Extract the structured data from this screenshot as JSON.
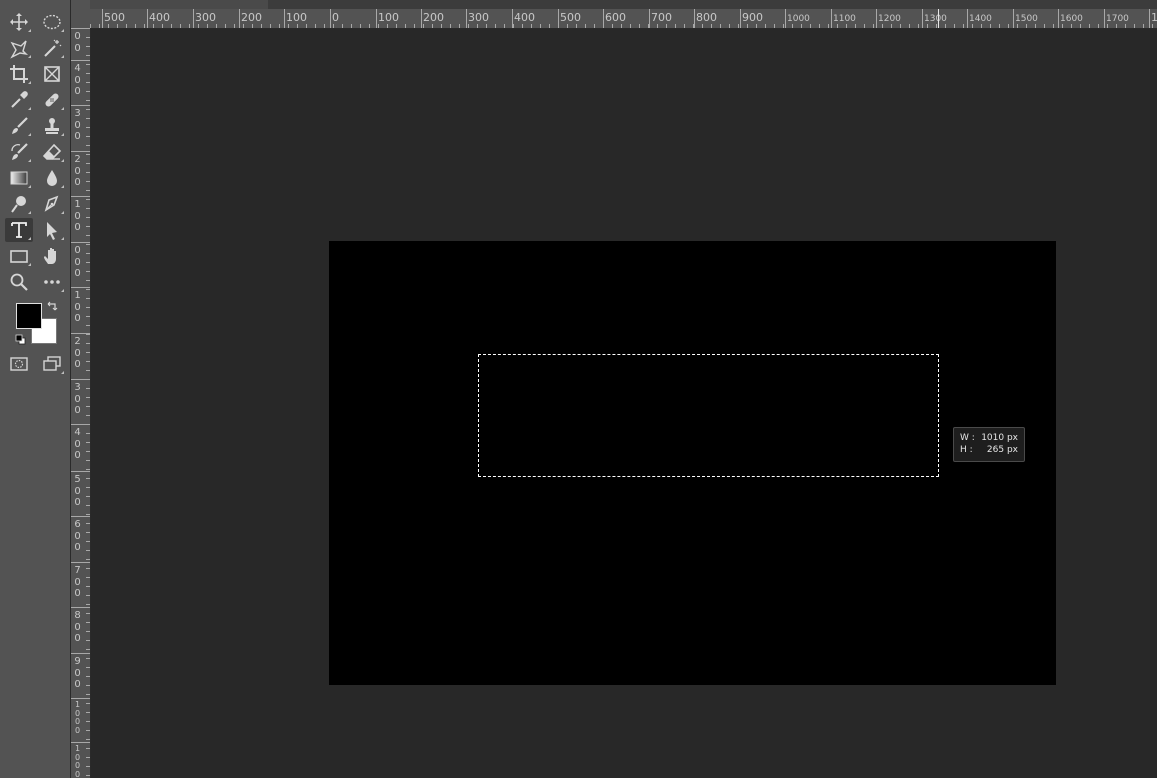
{
  "tools": [
    {
      "name": "move-tool",
      "icon": "move-icon",
      "active": false
    },
    {
      "name": "elliptical-marquee-tool",
      "icon": "ellipse-marquee-icon",
      "active": false
    },
    {
      "name": "lasso-tool",
      "icon": "lasso-icon",
      "active": false
    },
    {
      "name": "magic-wand-tool",
      "icon": "magic-wand-icon",
      "active": false
    },
    {
      "name": "crop-tool",
      "icon": "crop-icon",
      "active": false
    },
    {
      "name": "frame-tool",
      "icon": "frame-icon",
      "active": false
    },
    {
      "name": "eyedropper-tool",
      "icon": "eyedropper-icon",
      "active": false
    },
    {
      "name": "healing-brush-tool",
      "icon": "bandage-icon",
      "active": false
    },
    {
      "name": "brush-tool",
      "icon": "brush-icon",
      "active": false
    },
    {
      "name": "clone-stamp-tool",
      "icon": "stamp-icon",
      "active": false
    },
    {
      "name": "history-brush-tool",
      "icon": "history-brush-icon",
      "active": false
    },
    {
      "name": "eraser-tool",
      "icon": "eraser-icon",
      "active": false
    },
    {
      "name": "gradient-tool",
      "icon": "gradient-icon",
      "active": false
    },
    {
      "name": "blur-tool",
      "icon": "drop-icon",
      "active": false
    },
    {
      "name": "dodge-tool",
      "icon": "dodge-icon",
      "active": false
    },
    {
      "name": "pen-tool",
      "icon": "pen-icon",
      "active": false
    },
    {
      "name": "type-tool",
      "icon": "type-icon",
      "active": true
    },
    {
      "name": "path-selection-tool",
      "icon": "arrow-pointer-icon",
      "active": false
    },
    {
      "name": "rectangle-tool",
      "icon": "rectangle-icon",
      "active": false
    },
    {
      "name": "hand-tool",
      "icon": "hand-icon",
      "active": false
    },
    {
      "name": "zoom-tool",
      "icon": "magnifier-icon",
      "active": false
    },
    {
      "name": "edit-toolbar",
      "icon": "more-dots-icon",
      "active": false
    },
    {
      "name": "quick-mask-mode",
      "icon": "quick-mask-icon",
      "active": false
    },
    {
      "name": "screen-mode",
      "icon": "screen-mode-icon",
      "active": false
    }
  ],
  "colors": {
    "foreground": "#000000",
    "background": "#ffffff",
    "workspace": "#282828",
    "panel": "#535353",
    "document": "#000000"
  },
  "h_ruler_labels": [
    "500",
    "400",
    "300",
    "200",
    "100",
    "0",
    "100",
    "200",
    "300",
    "400",
    "500",
    "600",
    "700",
    "800",
    "900",
    "1000",
    "1100",
    "1200",
    "1300",
    "1400",
    "1500",
    "1600",
    "1700",
    "1"
  ],
  "v_ruler_labels": [
    "0",
    "4",
    "3",
    "2",
    "1",
    "0",
    "1",
    "2",
    "3",
    "4",
    "5",
    "6",
    "7",
    "8",
    "9",
    "1",
    "1"
  ],
  "measure": {
    "w_label": "W :",
    "w_value": "1010 px",
    "h_label": "H :",
    "h_value": "265 px"
  }
}
